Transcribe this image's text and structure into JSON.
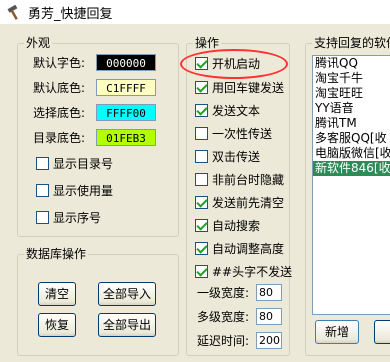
{
  "window": {
    "title": "勇芳_快捷回复"
  },
  "appearance": {
    "group_title": "外观",
    "rows": [
      {
        "label": "默认字色:",
        "value": "000000",
        "bg": "#000000",
        "fg": "#ffffff"
      },
      {
        "label": "默认底色:",
        "value": "C1FFFF",
        "bg": "#ffffc1",
        "fg": "#000000"
      },
      {
        "label": "选择底色:",
        "value": "FFFF00",
        "bg": "#00ffff",
        "fg": "#000000"
      },
      {
        "label": "目录底色:",
        "value": "01FEB3",
        "bg": "#b3fe01",
        "fg": "#000000"
      }
    ],
    "checkboxes": [
      {
        "label": "显示目录号",
        "checked": false
      },
      {
        "label": "显示使用量",
        "checked": false
      },
      {
        "label": "显示序号",
        "checked": false
      }
    ]
  },
  "database": {
    "group_title": "数据库操作",
    "buttons": [
      "清空",
      "全部导入",
      "恢复",
      "全部导出"
    ]
  },
  "operations": {
    "group_title": "操作",
    "checkboxes": [
      {
        "label": "开机启动",
        "checked": true
      },
      {
        "label": "用回车键发送",
        "checked": true
      },
      {
        "label": "发送文本",
        "checked": true
      },
      {
        "label": "一次性传送",
        "checked": false
      },
      {
        "label": "双击传送",
        "checked": false
      },
      {
        "label": "非前台时隐藏",
        "checked": false
      },
      {
        "label": "发送前先清空",
        "checked": true
      },
      {
        "label": "自动搜索",
        "checked": true
      },
      {
        "label": "自动调整高度",
        "checked": true
      },
      {
        "label": "##头字不发送",
        "checked": true
      }
    ],
    "fields": [
      {
        "label": "一级宽度:",
        "value": "80"
      },
      {
        "label": "多级宽度:",
        "value": "80"
      },
      {
        "label": "延迟时间:",
        "value": "200"
      }
    ]
  },
  "software": {
    "group_title": "支持回复的软件",
    "items": [
      "腾讯QQ",
      "淘宝千牛",
      "淘宝旺旺",
      "YY语音",
      "腾讯TM",
      "多客服QQ[收",
      "电脑版微信[收",
      "新软件846[收"
    ],
    "selected_index": 7,
    "new_button": "新增"
  },
  "colors": {
    "selected_item": "#2e8b57",
    "highlight": "#ff3030",
    "window_bg": "#ece9d8"
  }
}
